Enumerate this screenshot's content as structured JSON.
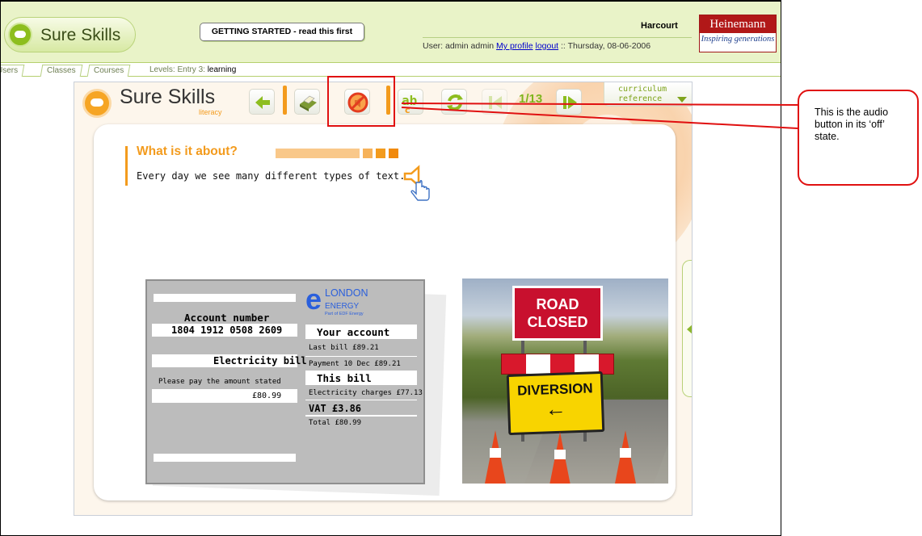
{
  "header": {
    "brand": "Sure Skills",
    "getting_started": "GETTING STARTED - read this first",
    "org": "Harcourt",
    "user_prefix": "User: admin admin",
    "my_profile": "My profile",
    "logout": "logout",
    "date": ":: Thursday, 08-06-2006",
    "publisher": "Heinemann",
    "publisher_tagline": "Inspiring generations"
  },
  "tabs": [
    {
      "label": "Users"
    },
    {
      "label": "Classes"
    },
    {
      "label": "Courses"
    }
  ],
  "levels": {
    "prefix": "Levels: Entry 3:",
    "current": "learning"
  },
  "app": {
    "brand": "Sure Skills",
    "brand_sub": "literacy",
    "page_indicator": "1/13",
    "curriculum_ref_line1": "curriculum",
    "curriculum_ref_line2": "reference",
    "section_title": "What is it about?",
    "section_text": "Every day we see many different types of text."
  },
  "bill": {
    "account_label": "Account number",
    "account_number": "1804 1912 0508 2609",
    "electricity_bill": "Electricity bill",
    "please_pay": "Please pay the amount stated",
    "amount": "£80.99",
    "brand_letter": "e",
    "brand_line1": "LONDON",
    "brand_line2": "ENERGY",
    "brand_line3": "Part of EDF Energy",
    "your_account": "Your account",
    "last_bill": "Last bill £89.21",
    "payment": "Payment 10 Dec £89.21",
    "this_bill": "This bill",
    "electricity_charges": "Electricity charges £77.13",
    "vat": "VAT £3.86",
    "total": "Total £80.99"
  },
  "photo": {
    "sign_road": "ROAD",
    "sign_closed": "CLOSED",
    "sign_diversion": "DIVERSION",
    "diversion_arrow": "←"
  },
  "callout": {
    "text": "This is the audio button in its ‘off’ state."
  },
  "colors": {
    "accent_orange": "#f39b1d",
    "accent_green": "#7fb51d",
    "callout_red": "#e01010"
  },
  "icons": {
    "back": "arrow-left-icon",
    "print": "printer-icon",
    "audio_off": "audio-off-icon",
    "glossary": "ab-text-icon",
    "refresh": "refresh-icon",
    "prev": "previous-page-icon",
    "next": "next-page-icon",
    "speaker": "speaker-icon",
    "hand": "hand-pointer-icon"
  }
}
